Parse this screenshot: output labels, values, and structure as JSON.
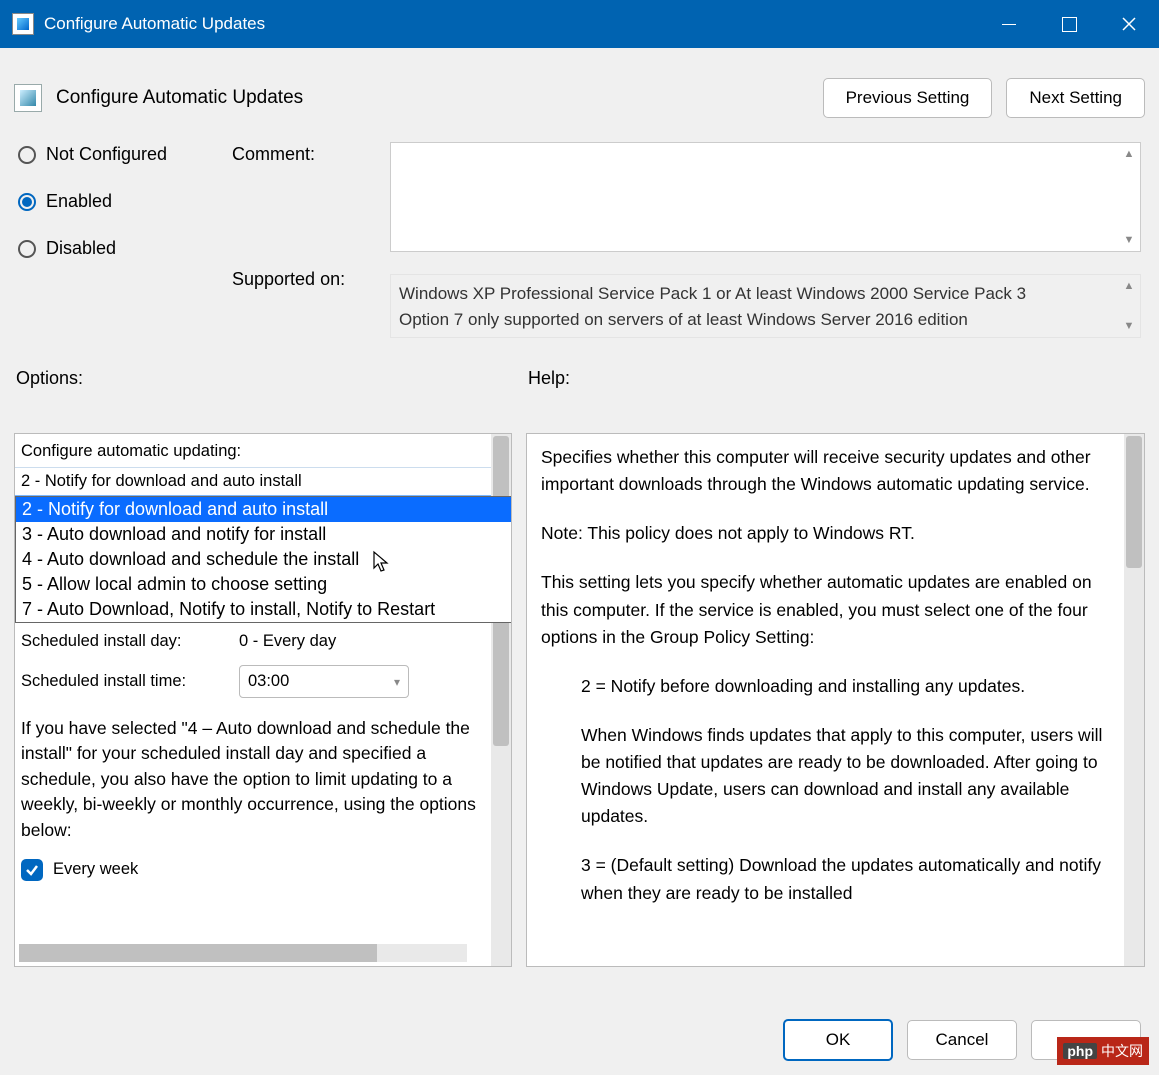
{
  "window": {
    "title": "Configure Automatic Updates"
  },
  "header": {
    "title": "Configure Automatic Updates",
    "prev": "Previous Setting",
    "next": "Next Setting"
  },
  "state": {
    "labels": {
      "not_configured": "Not Configured",
      "enabled": "Enabled",
      "disabled": "Disabled"
    },
    "selected": "enabled"
  },
  "comment": {
    "label": "Comment:",
    "value": ""
  },
  "supported": {
    "label": "Supported on:",
    "line1": "Windows XP Professional Service Pack 1 or At least Windows 2000 Service Pack 3",
    "line2": "Option 7 only supported on servers of at least Windows Server 2016 edition"
  },
  "options": {
    "section_label": "Options:",
    "config_label": "Configure automatic updating:",
    "selected_value": "2 - Notify for download and auto install",
    "dropdown": [
      "2 - Notify for download and auto install",
      "3 - Auto download and notify for install",
      "4 - Auto download and schedule the install",
      "5 - Allow local admin to choose setting",
      "7 - Auto Download, Notify to install, Notify to Restart"
    ],
    "dropdown_highlight_index": 0,
    "schedule_day": {
      "label": "Scheduled install day:",
      "value": "0 - Every day"
    },
    "schedule_time": {
      "label": "Scheduled install time:",
      "value": "03:00"
    },
    "note": "If you have selected \"4 – Auto download and schedule the install\" for your scheduled install day and specified a schedule, you also have the option to limit updating to a weekly, bi-weekly or monthly occurrence, using the options below:",
    "every_week": {
      "label": "Every week",
      "checked": true
    }
  },
  "help": {
    "section_label": "Help:",
    "p1": "Specifies whether this computer will receive security updates and other important downloads through the Windows automatic updating service.",
    "p2": "Note: This policy does not apply to Windows RT.",
    "p3": "This setting lets you specify whether automatic updates are enabled on this computer. If the service is enabled, you must select one of the four options in the Group Policy Setting:",
    "p4": "2 = Notify before downloading and installing any updates.",
    "p5": "When Windows finds updates that apply to this computer, users will be notified that updates are ready to be downloaded. After going to Windows Update, users can download and install any available updates.",
    "p6": "3 = (Default setting) Download the updates automatically and notify when they are ready to be installed"
  },
  "footer": {
    "ok": "OK",
    "cancel": "Cancel"
  },
  "badge": {
    "text": "php"
  }
}
